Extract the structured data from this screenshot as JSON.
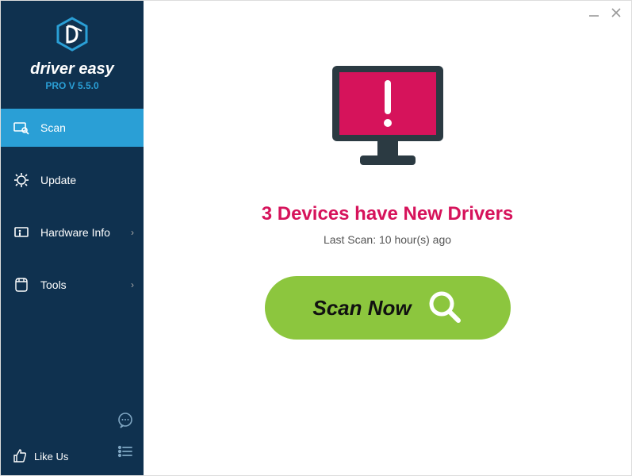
{
  "brand": "driver easy",
  "version": "PRO V 5.5.0",
  "sidebar": {
    "items": [
      {
        "label": "Scan"
      },
      {
        "label": "Update"
      },
      {
        "label": "Hardware Info"
      },
      {
        "label": "Tools"
      }
    ],
    "like_us": "Like Us"
  },
  "main": {
    "alert_title": "3 Devices have New Drivers",
    "last_scan": "Last Scan: 10 hour(s) ago",
    "scan_button": "Scan Now"
  },
  "colors": {
    "sidebar_bg": "#0f314f",
    "accent": "#2a9fd6",
    "alert": "#d6135b",
    "primary_button": "#8cc63e"
  }
}
